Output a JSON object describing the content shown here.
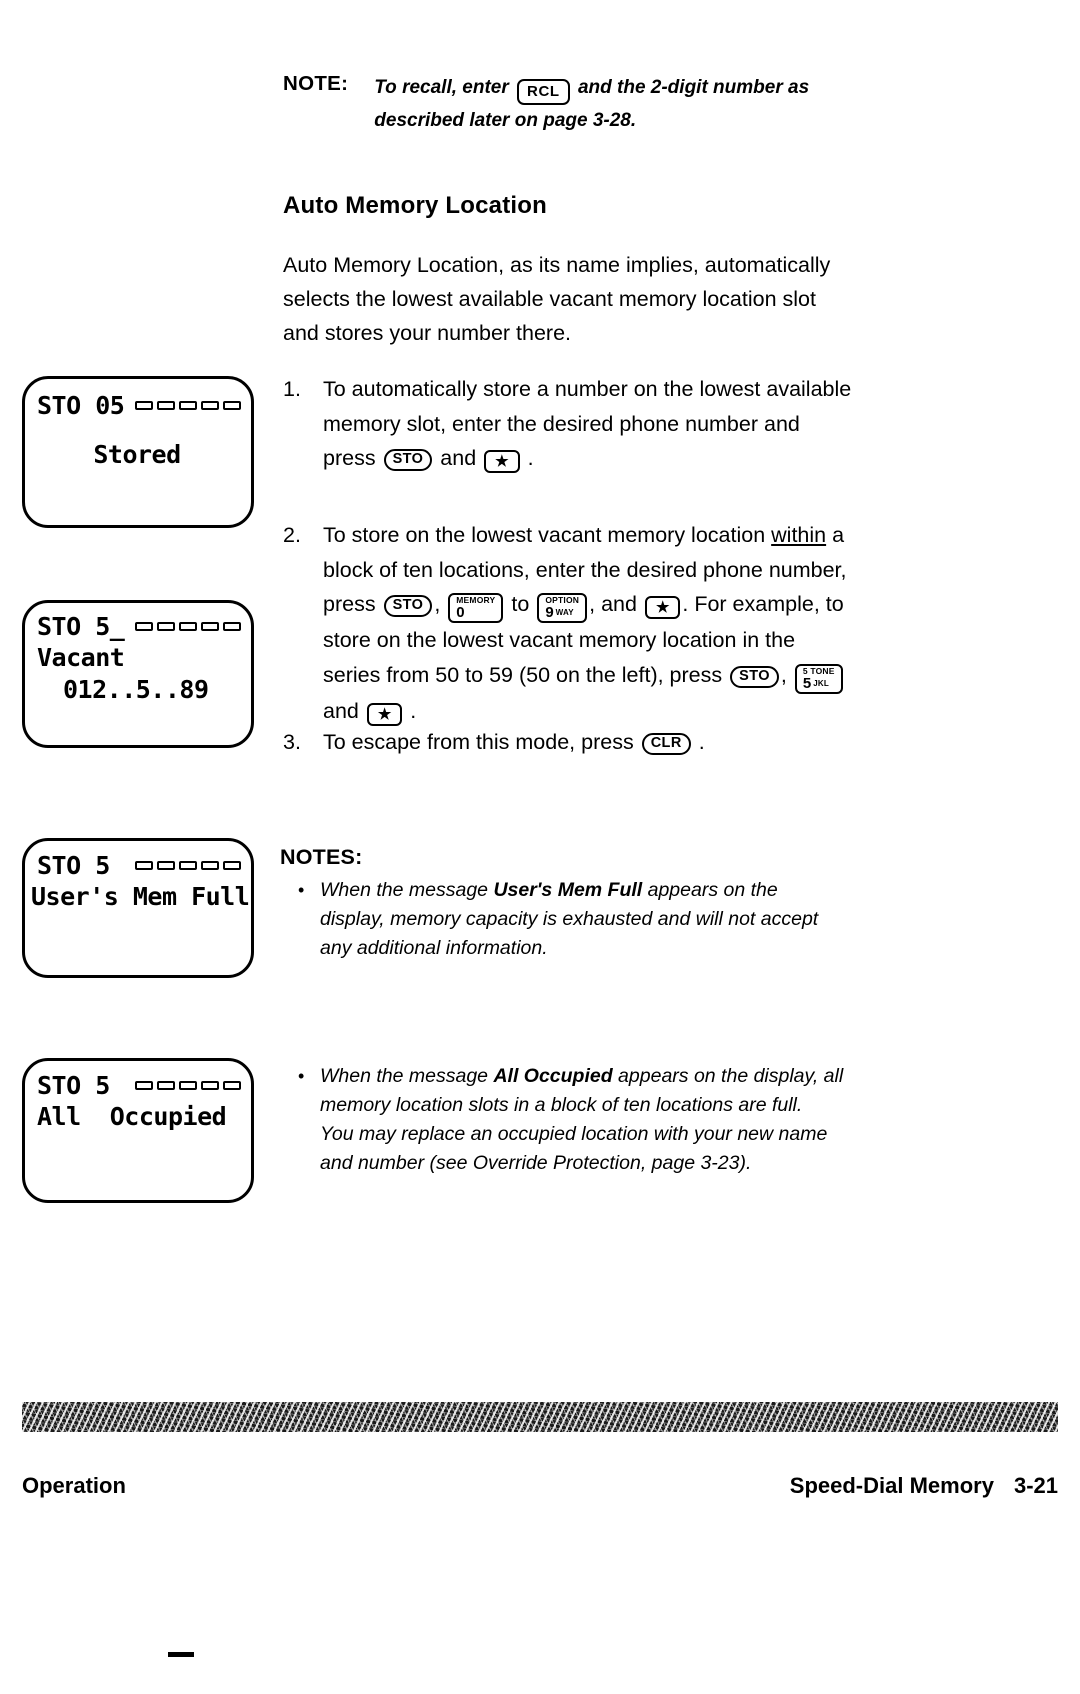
{
  "note_top": {
    "label": "NOTE:",
    "line1_a": "To recall, enter",
    "key_rcl": "RCL",
    "line1_b": "and the 2-digit number as",
    "line2": "described later on page 3-28."
  },
  "section": {
    "title": "Auto Memory Location",
    "intro": [
      "Auto Memory Location, as its name implies, automatically",
      "selects the lowest available vacant memory location slot",
      "and stores your number there."
    ]
  },
  "steps": [
    {
      "num": "1.",
      "lines": [
        "To automatically store a number on the lowest available",
        "memory slot, enter the desired phone number and"
      ],
      "last_line_pre": "press",
      "key_sto": "STO",
      "last_line_mid": "and",
      "key_star": "★",
      "last_line_post": "."
    },
    {
      "num": "2.",
      "line1_a": "To store on the lowest vacant memory location ",
      "line1_underline": "within",
      "line1_b": " a",
      "line2": "block of ten locations, enter the desired phone number,",
      "line3_pre": "press",
      "line3_sto": "STO",
      "line3_comma": ",",
      "key_memory_top": "MEMORY",
      "key_memory_bot": "0",
      "line3_to": "to",
      "key_option_top": "OPTION",
      "key_option_bot": "9",
      "key_option_sfx": "WAY",
      "line3_and": ", and",
      "line3_star": "★",
      "line3_post": ". For example, to",
      "line4": "store on the lowest vacant memory location in the",
      "line5_pre": "series from 50 to 59 (50 on the left), press",
      "line5_sto": "STO",
      "line5_comma": ",",
      "key_five_top": "5 TONE",
      "key_five_bot": "5",
      "key_five_sfx": "JKL",
      "line6_pre": "and",
      "line6_star": "★",
      "line6_post": "."
    },
    {
      "num": "3.",
      "line_pre": "To escape from this mode, press",
      "key_clr": "CLR",
      "line_post": "."
    }
  ],
  "lcds": [
    {
      "name": "stored",
      "line1": "STO 05",
      "line2": "Stored",
      "bars": 5
    },
    {
      "name": "vacant",
      "line1": "STO 5_",
      "line2": "Vacant",
      "line3": "012..5..89",
      "bars": 5
    },
    {
      "name": "users-mem-full",
      "line1": "STO 5",
      "line2": "User's Mem Full",
      "bars": 5
    },
    {
      "name": "all-occupied",
      "line1": "STO 5",
      "line2": "All  Occupied",
      "bars": 5
    }
  ],
  "notes": {
    "heading": "NOTES:",
    "bullets": [
      {
        "lines": [
          "When the message User's Mem Full appears on the",
          "display, memory capacity is exhausted and will not accept",
          "any additional information."
        ],
        "bold_phrase": "User's Mem Full"
      },
      {
        "lines": [
          "When the message All Occupied appears on the display, all",
          "memory location slots in a block of ten locations are full.",
          "You may replace an occupied location with your new name",
          "and number (see Override Protection, page 3-23)."
        ],
        "bold_phrase": "All Occupied"
      }
    ]
  },
  "footer": {
    "left": "Operation",
    "right": "Speed-Dial Memory",
    "page": "3-21"
  }
}
